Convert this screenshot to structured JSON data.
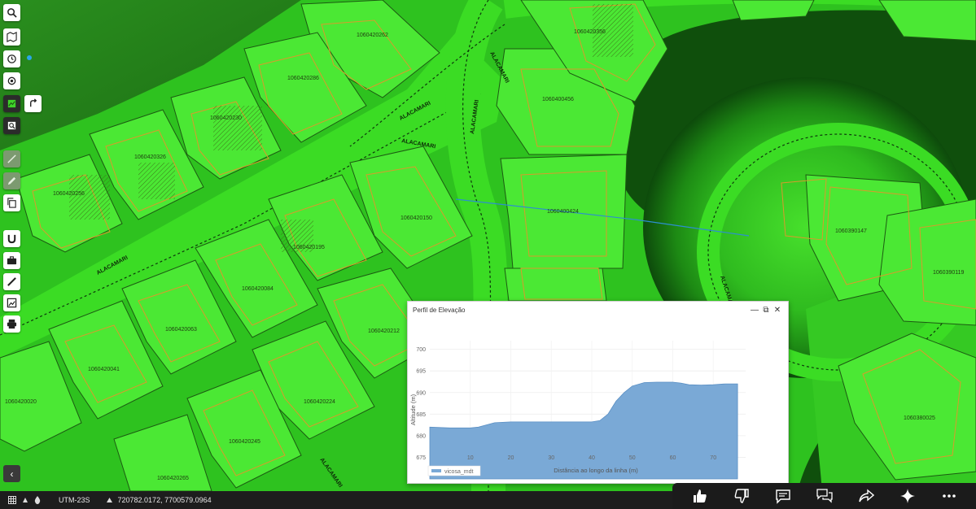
{
  "map": {
    "parcels": [
      "1060420262",
      "1060420286",
      "1060420230",
      "1060420326",
      "1060420256",
      "1060420150",
      "1060420195",
      "1060420356",
      "1060420084",
      "1060420063",
      "1060420041",
      "1060420212",
      "1060420020",
      "1060420224",
      "1060420245",
      "1060420265",
      "1060400456",
      "1060400424",
      "1060390147",
      "1060390119",
      "1060380025",
      "1060400490"
    ],
    "streets": [
      "ALACAMARI",
      "ALACAMARI",
      "ALACAMARI",
      "ALACAMARI",
      "ALACAMARI",
      "ALACAMARI",
      "ALACAMARI"
    ]
  },
  "toolbar": {
    "buttons": [
      {
        "name": "search-icon"
      },
      {
        "name": "map-icon"
      },
      {
        "name": "history-icon"
      },
      {
        "name": "locate-icon"
      },
      {
        "name": "layers-icon"
      },
      {
        "name": "rotate-icon"
      },
      {
        "name": "zoom-icon"
      },
      {
        "name": "draw-line-icon"
      },
      {
        "name": "pencil-icon"
      },
      {
        "name": "copy-icon"
      },
      {
        "name": "magnet-icon"
      },
      {
        "name": "briefcase-icon"
      },
      {
        "name": "ruler-icon"
      },
      {
        "name": "image-icon"
      },
      {
        "name": "print-icon"
      }
    ]
  },
  "elevation_panel": {
    "title": "Perfil de Elevação",
    "minimize": "—",
    "restore": "⧉",
    "close": "✕",
    "legend_series": "vicosa_mdt"
  },
  "chart_data": {
    "type": "area",
    "title": "",
    "xlabel": "Distância ao longo da linha (m)",
    "ylabel": "Altitude (m)",
    "xlim": [
      0,
      78
    ],
    "ylim": [
      670,
      702
    ],
    "xticks": [
      10,
      20,
      30,
      40,
      50,
      60,
      70
    ],
    "yticks": [
      675,
      680,
      685,
      690,
      695,
      700
    ],
    "legend_position": "bottom-left",
    "grid": true,
    "color": "#7aa9d6",
    "series": [
      {
        "name": "vicosa_mdt",
        "x": [
          0,
          5,
          10,
          12,
          16,
          20,
          25,
          30,
          35,
          40,
          42,
          44,
          46,
          48,
          50,
          53,
          56,
          60,
          62,
          64,
          67,
          70,
          73,
          76
        ],
        "y": [
          682,
          681.8,
          681.8,
          682,
          683,
          683.2,
          683.2,
          683.2,
          683.2,
          683.2,
          683.5,
          685,
          688,
          690,
          691.5,
          692.3,
          692.4,
          692.4,
          692.2,
          691.8,
          691.7,
          691.8,
          692,
          692
        ]
      }
    ]
  },
  "status_bar": {
    "projection": "UTM-23S",
    "coordinates": "720782.0172, 7700579.0964",
    "collapse": "‹"
  },
  "reactions": [
    {
      "name": "thumbs-up-icon"
    },
    {
      "name": "thumbs-down-icon"
    },
    {
      "name": "comment-icon"
    },
    {
      "name": "chat-icon"
    },
    {
      "name": "share-icon"
    },
    {
      "name": "sparkle-icon"
    },
    {
      "name": "more-icon"
    }
  ]
}
